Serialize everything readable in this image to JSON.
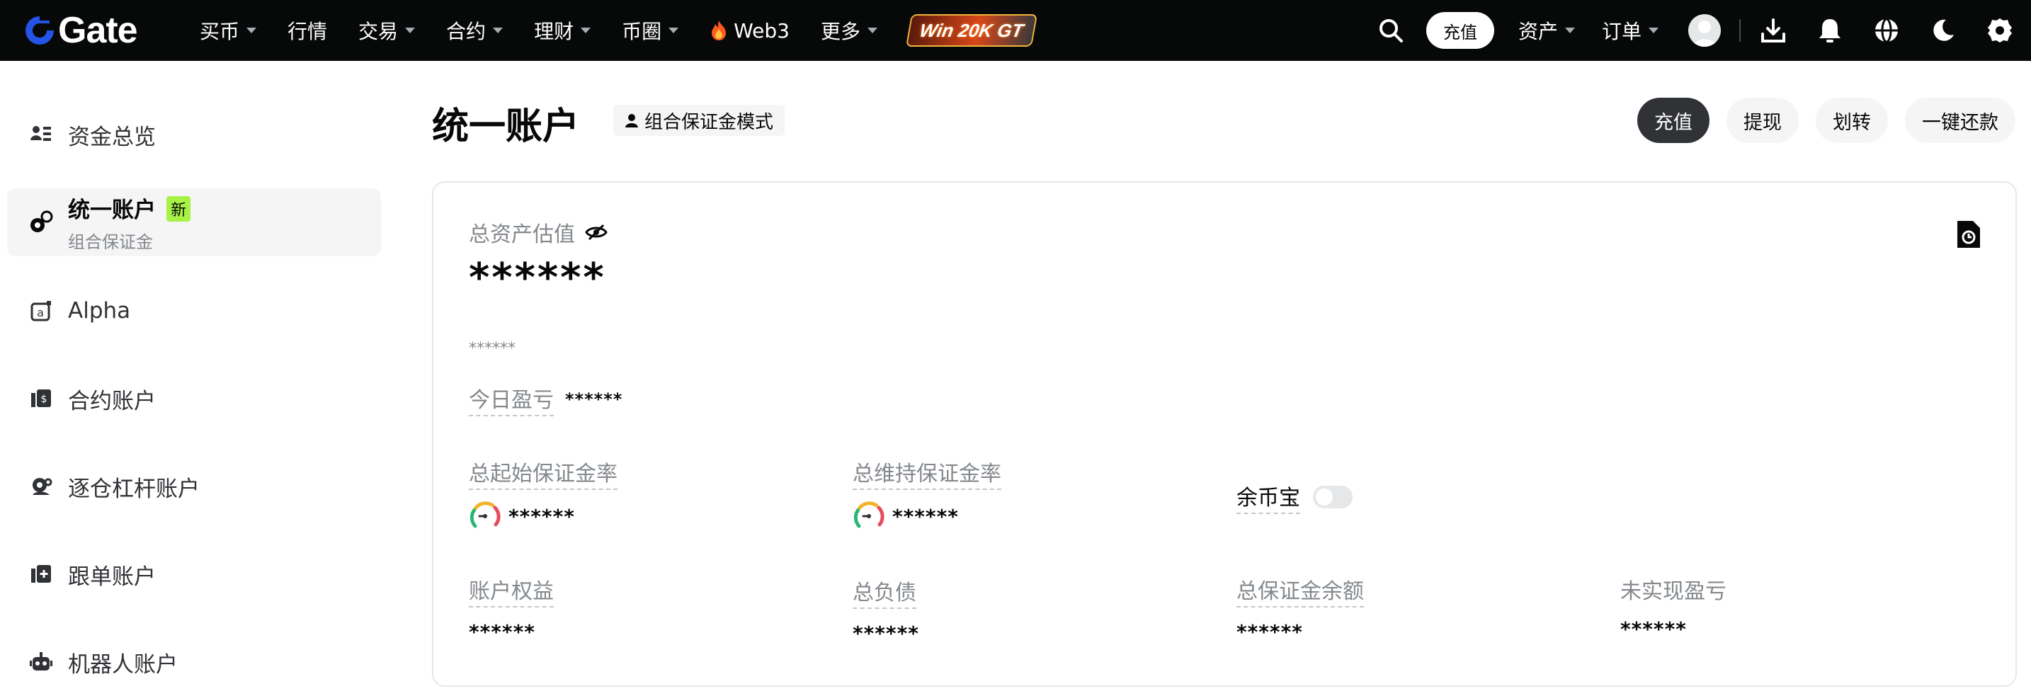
{
  "brand": {
    "name": "Gate"
  },
  "nav": {
    "items": [
      {
        "label": "买币",
        "has_menu": true
      },
      {
        "label": "行情",
        "has_menu": false
      },
      {
        "label": "交易",
        "has_menu": true
      },
      {
        "label": "合约",
        "has_menu": true
      },
      {
        "label": "理财",
        "has_menu": true
      },
      {
        "label": "币圈",
        "has_menu": true
      },
      {
        "label": "Web3",
        "has_menu": false
      },
      {
        "label": "更多",
        "has_menu": true
      }
    ],
    "promo_label": "Win 20K GT",
    "deposit_label": "充值",
    "assets_label": "资产",
    "orders_label": "订单"
  },
  "sidebar": {
    "items": [
      {
        "label": "资金总览",
        "icon": "overview-icon"
      },
      {
        "label": "统一账户",
        "sub": "组合保证金",
        "badge": "新",
        "icon": "unified-account-icon",
        "active": true
      },
      {
        "label": "Alpha",
        "icon": "alpha-icon"
      },
      {
        "label": "合约账户",
        "icon": "futures-account-icon"
      },
      {
        "label": "逐仓杠杆账户",
        "icon": "margin-account-icon"
      },
      {
        "label": "跟单账户",
        "icon": "copy-trading-icon"
      },
      {
        "label": "机器人账户",
        "icon": "bot-icon"
      }
    ]
  },
  "header": {
    "title": "统一账户",
    "mode_tag": "组合保证金模式",
    "actions": [
      "充值",
      "提现",
      "划转",
      "一键还款"
    ]
  },
  "card": {
    "total_label": "总资产估值",
    "total_value": "******",
    "total_sub_value": "******",
    "pnl_label": "今日盈亏",
    "pnl_value": "******",
    "initial_margin_label": "总起始保证金率",
    "initial_margin_value": "******",
    "maintenance_margin_label": "总维持保证金率",
    "maintenance_margin_value": "******",
    "yubibao_label": "余币宝",
    "yubibao_enabled": false,
    "equity_label": "账户权益",
    "equity_value": "******",
    "liability_label": "总负债",
    "liability_value": "******",
    "margin_balance_label": "总保证金余额",
    "margin_balance_value": "******",
    "unrealized_label": "未实现盈亏",
    "unrealized_value": "******"
  },
  "colors": {
    "topbar_bg": "#070808",
    "accent_green": "#a7f246",
    "brand_blue": "#2354e6",
    "primary_button": "#303236",
    "muted_text": "#84888c",
    "gauge_green": "#2bb673",
    "gauge_yellow": "#f2b32b",
    "gauge_red": "#e84a5f"
  }
}
